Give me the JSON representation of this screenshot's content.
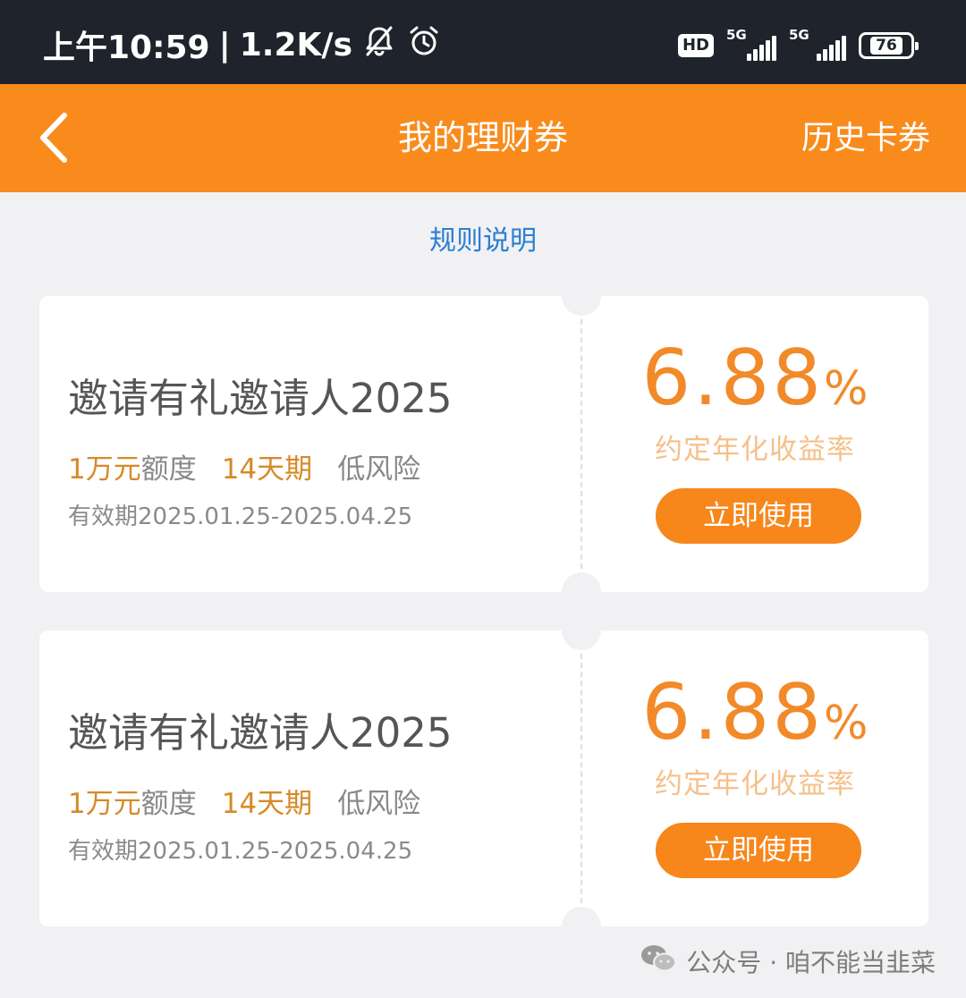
{
  "status_bar": {
    "time": "上午10:59",
    "separator": "|",
    "net_speed": "1.2K/s",
    "hd_label": "HD",
    "sim1_label": "5G",
    "sim2_label": "5G",
    "battery": "76",
    "battery_level": 0.76
  },
  "header": {
    "title": "我的理财券",
    "history_label": "历史卡券"
  },
  "rules_link": "规则说明",
  "coupons": [
    {
      "name": "邀请有礼邀请人2025",
      "quota_amount": "1万元",
      "quota_suffix": "额度",
      "term": "14天期",
      "risk": "低风险",
      "validity": "有效期2025.01.25-2025.04.25",
      "rate_value": "6.88",
      "rate_unit": "%",
      "rate_label": "约定年化收益率",
      "button_label": "立即使用"
    },
    {
      "name": "邀请有礼邀请人2025",
      "quota_amount": "1万元",
      "quota_suffix": "额度",
      "term": "14天期",
      "risk": "低风险",
      "validity": "有效期2025.01.25-2025.04.25",
      "rate_value": "6.88",
      "rate_unit": "%",
      "rate_label": "约定年化收益率",
      "button_label": "立即使用"
    }
  ],
  "watermark": {
    "text": "公众号 · 咱不能当韭菜",
    "icon": "wechat-icon"
  },
  "colors": {
    "header_orange": "#f98b1d",
    "status_bar_bg": "#1f232b",
    "rate_orange": "#f28a2a",
    "link_blue": "#2b7ed3"
  }
}
